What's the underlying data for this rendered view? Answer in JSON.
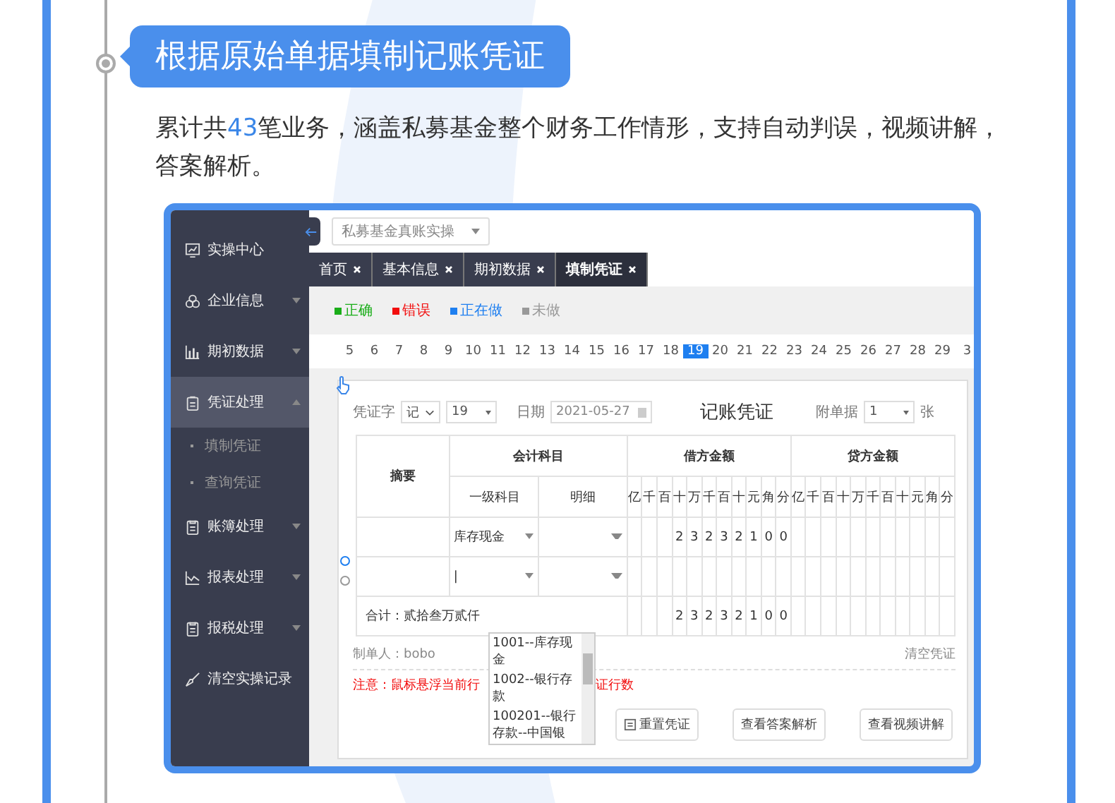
{
  "title": "根据原始单据填制记账凭证",
  "intro": {
    "before": "累计共",
    "highlight": "43",
    "after": "笔业务，涵盖私募基金整个财务工作情形，支持自动判误，视频讲解，答案解析。"
  },
  "screen": {
    "sidebar": [
      {
        "label": "实操中心",
        "kind": "link",
        "selected": false
      },
      {
        "label": "企业信息",
        "kind": "group",
        "expanded": false,
        "selected": false
      },
      {
        "label": "期初数据",
        "kind": "group",
        "expanded": false,
        "selected": false
      },
      {
        "label": "凭证处理",
        "kind": "group",
        "expanded": true,
        "selected": true,
        "children": [
          {
            "label": "填制凭证"
          },
          {
            "label": "查询凭证"
          }
        ]
      },
      {
        "label": "账簿处理",
        "kind": "group",
        "expanded": false,
        "selected": false
      },
      {
        "label": "报表处理",
        "kind": "group",
        "expanded": false,
        "selected": false
      },
      {
        "label": "报税处理",
        "kind": "group",
        "expanded": false,
        "selected": false
      },
      {
        "label": "清空实操记录",
        "kind": "link",
        "selected": false
      }
    ],
    "course_select": "私募基金真账实操",
    "tabs": [
      {
        "label": "首页",
        "selected": false
      },
      {
        "label": "基本信息",
        "selected": false
      },
      {
        "label": "期初数据",
        "selected": false
      },
      {
        "label": "填制凭证",
        "selected": true
      }
    ],
    "legend": [
      {
        "label": "正确",
        "color": "#1aad19"
      },
      {
        "label": "错误",
        "color": "#f20d0d"
      },
      {
        "label": "正在做",
        "color": "#1e7ff0"
      },
      {
        "label": "未做",
        "color": "#999999"
      }
    ],
    "numbers": [
      {
        "label": "5",
        "selected": false
      },
      {
        "label": "6",
        "selected": false
      },
      {
        "label": "7",
        "selected": false
      },
      {
        "label": "8",
        "selected": false
      },
      {
        "label": "9",
        "selected": false
      },
      {
        "label": "10",
        "selected": false
      },
      {
        "label": "11",
        "selected": false
      },
      {
        "label": "12",
        "selected": false
      },
      {
        "label": "13",
        "selected": false
      },
      {
        "label": "14",
        "selected": false
      },
      {
        "label": "15",
        "selected": false
      },
      {
        "label": "16",
        "selected": false
      },
      {
        "label": "17",
        "selected": false
      },
      {
        "label": "18",
        "selected": false
      },
      {
        "label": "19",
        "selected": true
      },
      {
        "label": "20",
        "selected": false
      },
      {
        "label": "21",
        "selected": false
      },
      {
        "label": "22",
        "selected": false
      },
      {
        "label": "23",
        "selected": false
      },
      {
        "label": "24",
        "selected": false
      },
      {
        "label": "25",
        "selected": false
      },
      {
        "label": "26",
        "selected": false
      },
      {
        "label": "27",
        "selected": false
      },
      {
        "label": "28",
        "selected": false
      },
      {
        "label": "29",
        "selected": false
      },
      {
        "label": "3",
        "selected": false
      }
    ],
    "form": {
      "type_label": "凭证字",
      "type_value": "记",
      "number": "19",
      "date_label": "日期",
      "date": "2021-05-27",
      "heading": "记账凭证",
      "attach_label": "附单据",
      "attach_value": "1",
      "attach_unit": "张"
    },
    "table": {
      "summary_header": "摘要",
      "account_header": "会计科目",
      "debit_header": "借方金额",
      "credit_header": "贷方金额",
      "level1_header": "一级科目",
      "detail_header": "明细",
      "debit_units": [
        "亿",
        "千",
        "百",
        "十",
        "万",
        "千",
        "百",
        "十",
        "元",
        "角",
        "分"
      ],
      "credit_units": [
        "亿",
        "千",
        "百",
        "十",
        "万",
        "千",
        "百",
        "十",
        "元",
        "角",
        "分"
      ],
      "rows": [
        {
          "account": "库存现金",
          "debit": [
            "2",
            "3",
            "2",
            "3",
            "2",
            "1",
            "0",
            "0"
          ]
        },
        {
          "account": "|"
        }
      ],
      "total_label": "合计：贰拾叁万贰仟",
      "total_debit": [
        "2",
        "3",
        "2",
        "3",
        "2",
        "1",
        "0",
        "0"
      ],
      "dropdown": [
        "1001--库存现金",
        "1002--银行存款",
        "100201--银行存款--中国银"
      ]
    },
    "maker": "制单人：bobo",
    "clear": "清空凭证",
    "note": [
      "注意：鼠标悬浮当前行",
      "证行数"
    ],
    "buttons": [
      {
        "label": "重置凭证",
        "kind": "icon"
      },
      {
        "label": "查看答案解析",
        "kind": "plain"
      },
      {
        "label": "查看视频讲解",
        "kind": "plain"
      }
    ]
  }
}
